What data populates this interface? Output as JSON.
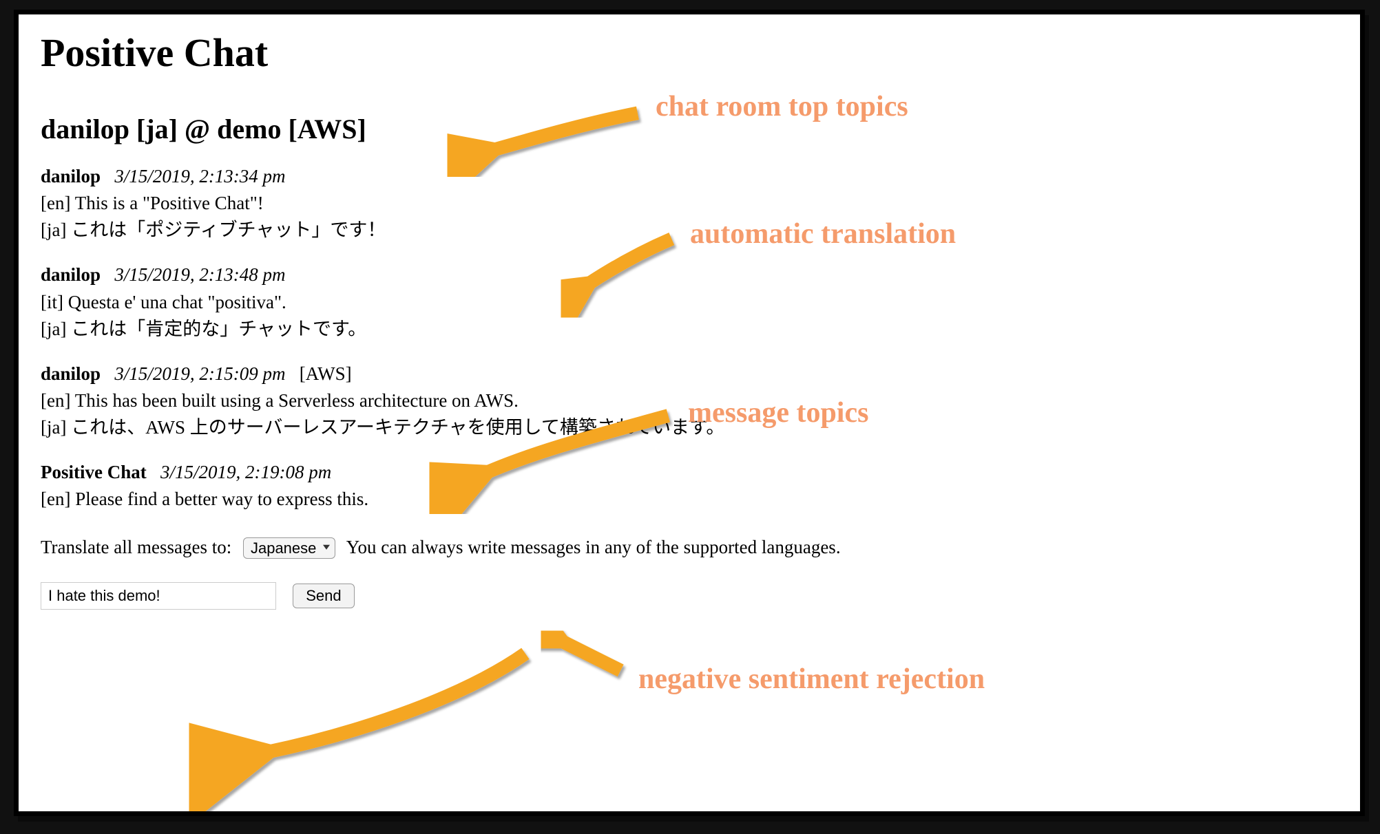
{
  "page": {
    "title": "Positive Chat",
    "room_header": "danilop [ja] @ demo [AWS]"
  },
  "messages": [
    {
      "user": "danilop",
      "timestamp": "3/15/2019, 2:13:34 pm",
      "topic": "",
      "lines": [
        "[en] This is a \"Positive Chat\"!",
        "[ja] これは「ポジティブチャット」です！"
      ]
    },
    {
      "user": "danilop",
      "timestamp": "3/15/2019, 2:13:48 pm",
      "topic": "",
      "lines": [
        "[it] Questa e' una chat \"positiva\".",
        "[ja] これは「肯定的な」チャットです。"
      ]
    },
    {
      "user": "danilop",
      "timestamp": "3/15/2019, 2:15:09 pm",
      "topic": "[AWS]",
      "lines": [
        "[en] This has been built using a Serverless architecture on AWS.",
        "[ja] これは、AWS 上のサーバーレスアーキテクチャを使用して構築されています。"
      ]
    },
    {
      "user": "Positive Chat",
      "timestamp": "3/15/2019, 2:19:08 pm",
      "topic": "",
      "lines": [
        "[en] Please find a better way to express this."
      ]
    }
  ],
  "controls": {
    "translate_label": "Translate all messages to:",
    "selected_language": "Japanese",
    "translate_note": "You can always write messages in any of the supported languages."
  },
  "compose": {
    "input_value": "I hate this demo!",
    "send_label": "Send"
  },
  "annotations": {
    "top_topics": "chat room top topics",
    "auto_translate": "automatic translation",
    "msg_topics": "message topics",
    "neg_reject": "negative sentiment rejection"
  },
  "colors": {
    "annotation": "#f59b6b",
    "arrow": "#f5a623"
  }
}
